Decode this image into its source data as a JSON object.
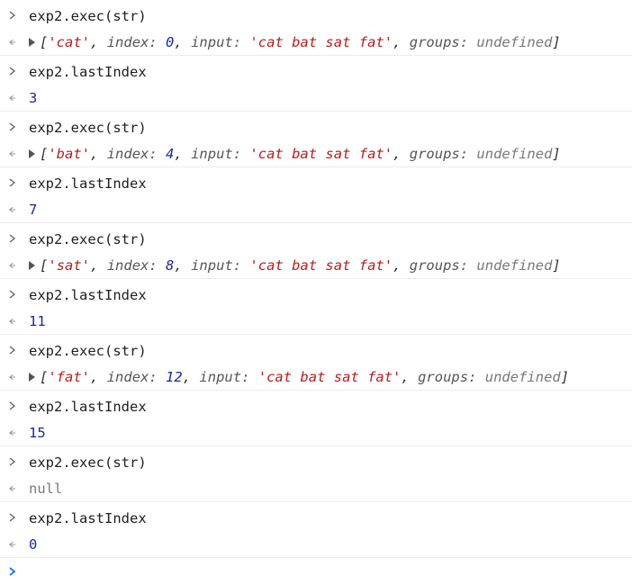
{
  "entries": [
    {
      "input": "exp2.exec(str)",
      "output_type": "array",
      "match": "'cat'",
      "index": "0",
      "input_str": "'cat bat sat fat'",
      "groups": "undefined"
    },
    {
      "input": "exp2.lastIndex",
      "output_type": "number",
      "value": "3"
    },
    {
      "input": "exp2.exec(str)",
      "output_type": "array",
      "match": "'bat'",
      "index": "4",
      "input_str": "'cat bat sat fat'",
      "groups": "undefined"
    },
    {
      "input": "exp2.lastIndex",
      "output_type": "number",
      "value": "7"
    },
    {
      "input": "exp2.exec(str)",
      "output_type": "array",
      "match": "'sat'",
      "index": "8",
      "input_str": "'cat bat sat fat'",
      "groups": "undefined"
    },
    {
      "input": "exp2.lastIndex",
      "output_type": "number",
      "value": "11"
    },
    {
      "input": "exp2.exec(str)",
      "output_type": "array",
      "match": "'fat'",
      "index": "12",
      "input_str": "'cat bat sat fat'",
      "groups": "undefined"
    },
    {
      "input": "exp2.lastIndex",
      "output_type": "number",
      "value": "15"
    },
    {
      "input": "exp2.exec(str)",
      "output_type": "null",
      "value": "null"
    },
    {
      "input": "exp2.lastIndex",
      "output_type": "number",
      "value": "0"
    }
  ],
  "labels": {
    "open_bracket": "[",
    "close_bracket": "]",
    "index_key": "index:",
    "input_key": "input:",
    "groups_key": "groups:",
    "comma": ","
  },
  "colors": {
    "string": "#b51e1e",
    "number": "#1d26a8",
    "key": "#565656",
    "prompt": "#1a73e8"
  },
  "icons": {
    "input_marker": "chevron-right-icon",
    "output_marker": "return-arrow-icon",
    "expand": "triangle-right-icon",
    "prompt": "prompt-chevron-icon"
  }
}
